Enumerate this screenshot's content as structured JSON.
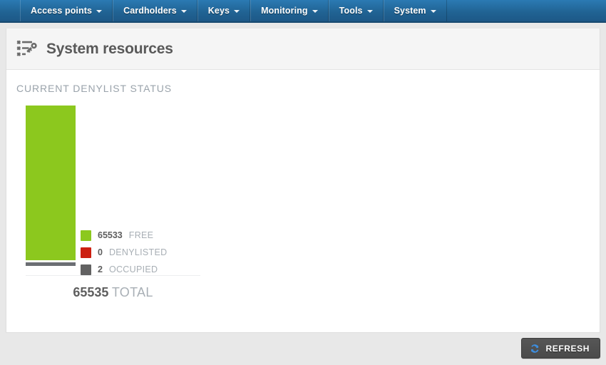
{
  "navbar": {
    "items": [
      {
        "label": "Access points",
        "icon": "chevron-down-icon"
      },
      {
        "label": "Cardholders",
        "icon": "chevron-down-icon"
      },
      {
        "label": "Keys",
        "icon": "chevron-down-icon"
      },
      {
        "label": "Monitoring",
        "icon": "chevron-down-icon"
      },
      {
        "label": "Tools",
        "icon": "chevron-down-icon"
      },
      {
        "label": "System",
        "icon": "chevron-down-icon"
      }
    ]
  },
  "header": {
    "title": "System resources",
    "icon": "list-key-icon"
  },
  "main": {
    "section_label": "CURRENT DENYLIST STATUS"
  },
  "chart_data": {
    "type": "bar",
    "title": "CURRENT DENYLIST STATUS",
    "categories": [
      "FREE",
      "DENYLISTED",
      "OCCUPIED"
    ],
    "values": [
      65533,
      0,
      2
    ],
    "colors": [
      "#8cc81e",
      "#cc1f11",
      "#626262"
    ],
    "stacked": true,
    "total_value": "65535",
    "total_label": "TOTAL",
    "legend_position": "right",
    "grid": false,
    "xlabel": "",
    "ylabel": "",
    "legend": [
      {
        "value": "65533",
        "name": "FREE",
        "color": "#8cc81e"
      },
      {
        "value": "0",
        "name": "DENYLISTED",
        "color": "#cc1f11"
      },
      {
        "value": "2",
        "name": "OCCUPIED",
        "color": "#626262"
      }
    ]
  },
  "footer": {
    "refresh_label": "REFRESH",
    "refresh_icon": "refresh-icon"
  },
  "colors": {
    "nav_blue": "#206292",
    "free_green": "#8cc81e",
    "denylisted_red": "#cc1f11",
    "occupied_gray": "#626262",
    "button_dark": "#4a4a4a",
    "refresh_icon_blue": "#3d8ddd"
  }
}
